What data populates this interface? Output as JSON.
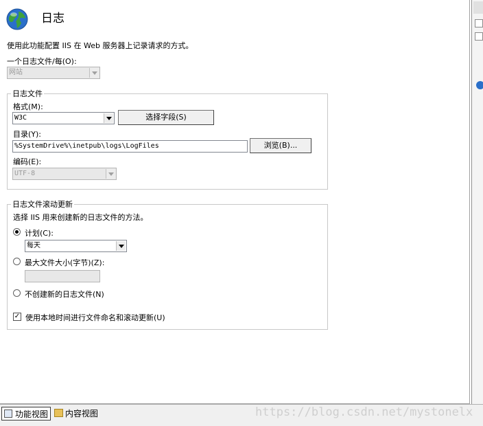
{
  "header": {
    "title": "日志",
    "description": "使用此功能配置 IIS 在 Web 服务器上记录请求的方式。"
  },
  "one_log_per": {
    "label": "一个日志文件/每(O):",
    "value": "网站"
  },
  "log_file": {
    "legend": "日志文件",
    "format_label": "格式(M):",
    "format_value": "W3C",
    "select_fields_button": "选择字段(S)",
    "directory_label": "目录(Y):",
    "directory_value": "%SystemDrive%\\inetpub\\logs\\LogFiles",
    "browse_button": "浏览(B)...",
    "encoding_label": "编码(E):",
    "encoding_value": "UTF-8"
  },
  "rollover": {
    "legend": "日志文件滚动更新",
    "description": "选择 IIS 用来创建新的日志文件的方法。",
    "schedule_label": "计划(C):",
    "schedule_value": "每天",
    "max_size_label": "最大文件大小(字节)(Z):",
    "max_size_value": "",
    "no_new_label": "不创建新的日志文件(N)",
    "local_time_label": "使用本地时间进行文件命名和滚动更新(U)"
  },
  "bottom": {
    "feature_view": "功能视图",
    "content_view": "内容视图"
  },
  "watermark": "https://blog.csdn.net/mystonelx",
  "colors": {
    "globe_blue": "#2a6fc9",
    "globe_green": "#3fa23a"
  }
}
